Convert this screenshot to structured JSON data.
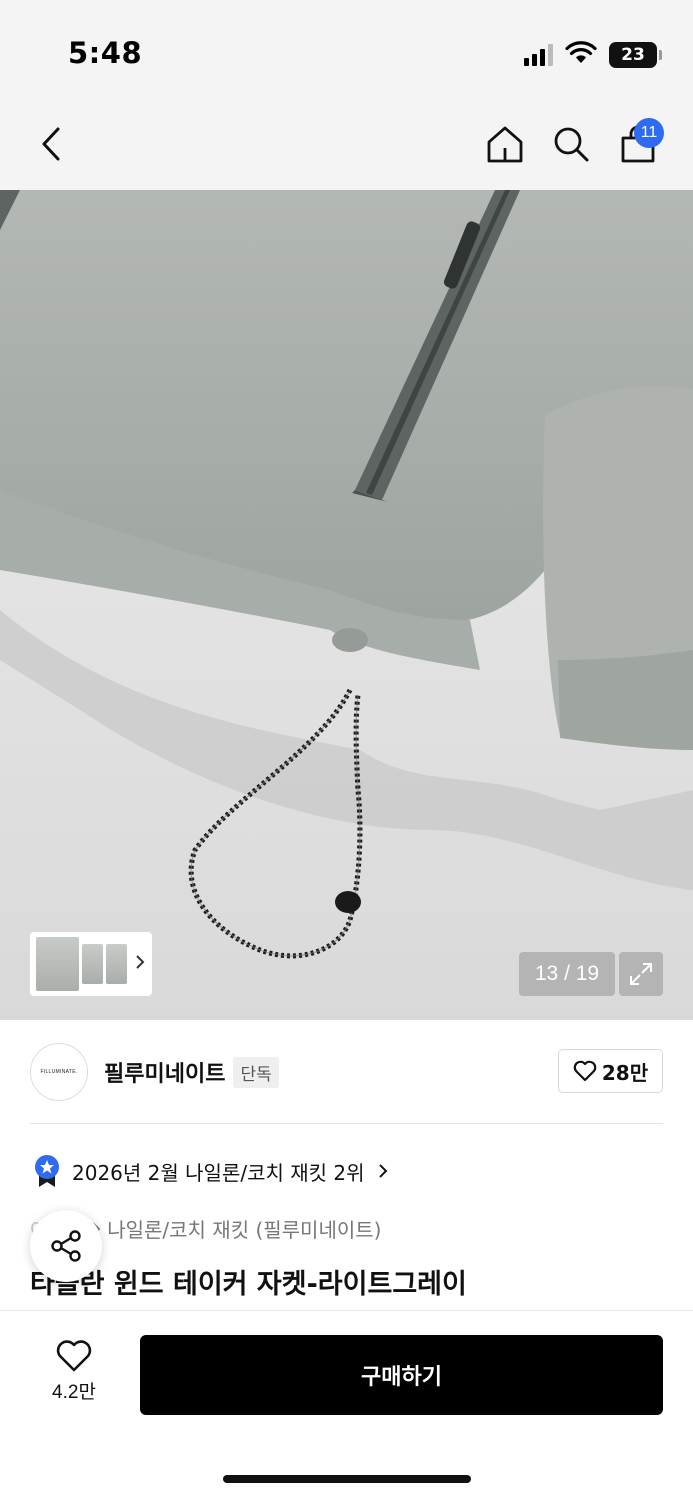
{
  "status_bar": {
    "time": "5:48",
    "battery": "23",
    "icons": [
      "signal-icon",
      "wifi-icon",
      "battery-icon"
    ]
  },
  "nav": {
    "icons": [
      "back-icon",
      "home-icon",
      "search-icon",
      "cart-icon"
    ],
    "cart_count": "11"
  },
  "gallery": {
    "counter": "13 / 19",
    "colors": {
      "jacket": "#a9afab",
      "zipper": "#5d6462"
    }
  },
  "brand": {
    "logo_text": "FILLUMINATE.",
    "name": "필루미네이트",
    "tag": "단독",
    "likes": "28만"
  },
  "ranking": {
    "text": "2026년 2월 나일론/코치 재킷 2위"
  },
  "category": {
    "parent": "아우터",
    "text": "나일론/코치 재킷 (필루미네이트)"
  },
  "product": {
    "title": "타슬란 윈드 테이커 자켓-라이트그레이"
  },
  "bottom_bar": {
    "wish_count": "4.2만",
    "buy_label": "구매하기"
  },
  "colors": {
    "accent": "#2f6bf0",
    "buy_button": "#000000"
  }
}
